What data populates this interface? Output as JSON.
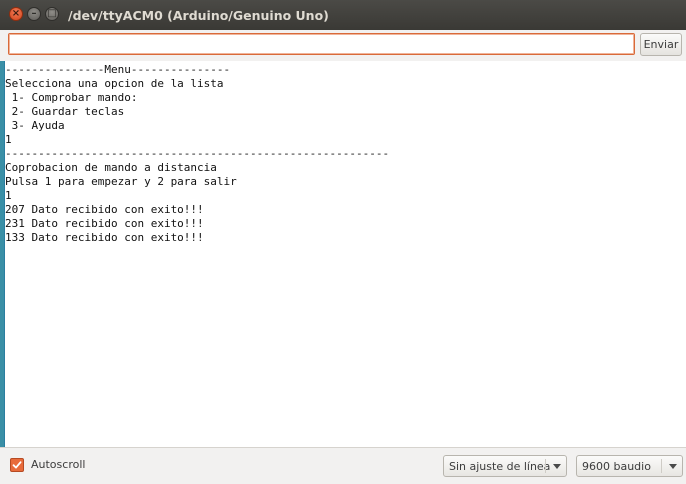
{
  "window": {
    "title": "/dev/ttyACM0 (Arduino/Genuino Uno)",
    "close_glyph": "×",
    "min_glyph": "–",
    "max_glyph": "□"
  },
  "send": {
    "input_value": "",
    "button_label": "Enviar"
  },
  "output": {
    "lines": [
      "---------------Menu---------------",
      "Selecciona una opcion de la lista",
      " 1- Comprobar mando:",
      " 2- Guardar teclas",
      " 3- Ayuda",
      "1",
      "----------------------------------------------------------",
      "Coprobacion de mando a distancia",
      "Pulsa 1 para empezar y 2 para salir",
      "1",
      "207 Dato recibido con exito!!!",
      "231 Dato recibido con exito!!!",
      "133 Dato recibido con exito!!!"
    ]
  },
  "bottom": {
    "autoscroll_label": "Autoscroll",
    "autoscroll_checked": true,
    "line_ending_selected": "Sin ajuste de línea",
    "baud_selected": "9600 baudio"
  },
  "colors": {
    "accent": "#e86b3b",
    "titlebar": "#3c3b37",
    "scroll_strip": "#3a8fa6"
  }
}
